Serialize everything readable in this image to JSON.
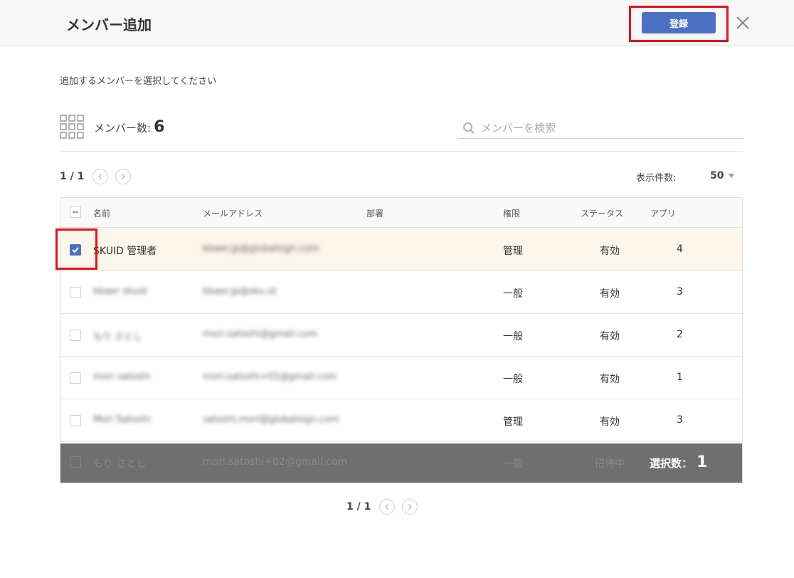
{
  "header": {
    "title": "メンバー追加",
    "register_label": "登録"
  },
  "instruction": "追加するメンバーを選択してください",
  "summary": {
    "count_label": "メンバー数:",
    "count": "6"
  },
  "search": {
    "placeholder": "メンバーを検索"
  },
  "pagination": {
    "top": "1 / 1",
    "bottom": "1 / 1"
  },
  "per_page": {
    "label": "表示件数:",
    "value": "50"
  },
  "columns": {
    "name": "名前",
    "email": "メールアドレス",
    "dept": "部署",
    "role": "権限",
    "status": "ステータス",
    "apps": "アプリ"
  },
  "rows": [
    {
      "name": "SKUID 管理者",
      "email": "kbaer.jp@globalsign.com",
      "dept": "",
      "role": "管理",
      "status": "有効",
      "apps": "4",
      "checked": true
    },
    {
      "name": "kbaer skuid",
      "email": "kbaer.jp@sku.id",
      "dept": "",
      "role": "一般",
      "status": "有効",
      "apps": "3",
      "checked": false
    },
    {
      "name": "もり さとし",
      "email": "mori.satoshi@gmail.com",
      "dept": "",
      "role": "一般",
      "status": "有効",
      "apps": "2",
      "checked": false
    },
    {
      "name": "mori satoshi",
      "email": "mori.satoshi+01@gmail.com",
      "dept": "",
      "role": "一般",
      "status": "有効",
      "apps": "1",
      "checked": false
    },
    {
      "name": "Mori Satoshi",
      "email": "satoshi.mori@globalsign.com",
      "dept": "",
      "role": "管理",
      "status": "有効",
      "apps": "3",
      "checked": false
    },
    {
      "name": "もり さとし",
      "email": "mori.satoshi+02@gmail.com",
      "dept": "",
      "role": "一般",
      "status": "招待中",
      "apps": "",
      "checked": false
    }
  ],
  "selection": {
    "label": "選択数：",
    "count": "1"
  },
  "colors": {
    "primary": "#4b70c4",
    "highlight": "#e8101a",
    "selected_row": "#fbf6ea",
    "overlay": "#6f6f6f"
  }
}
